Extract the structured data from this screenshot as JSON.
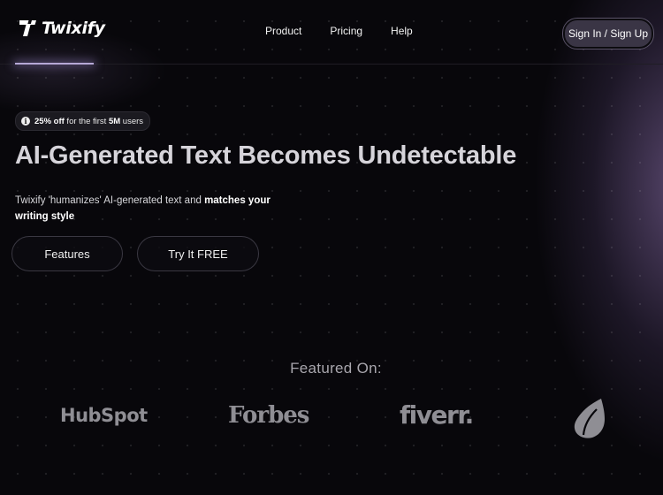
{
  "header": {
    "brand": "Twixify",
    "nav": [
      "Product",
      "Pricing",
      "Help"
    ],
    "signin_label": "Sign In / Sign Up"
  },
  "hero": {
    "promo": {
      "icon": "info-icon",
      "bold_discount": "25% off",
      "middle": " for the first ",
      "bold_count": "5M",
      "end": " users"
    },
    "headline": "AI-Generated Text Becomes Undetectable",
    "subtext_plain": "Twixify 'humanizes' AI-generated text and ",
    "subtext_bold": "matches your writing style",
    "buttons": {
      "features": "Features",
      "try_free": "Try It FREE"
    }
  },
  "featured": {
    "title": "Featured On:",
    "logos": [
      "HubSpot",
      "Forbes",
      "fiverr.",
      "Envato"
    ]
  },
  "colors": {
    "background": "#08070b",
    "accent_glow": "#9678b9",
    "logo_gray": "#8f8e94"
  }
}
